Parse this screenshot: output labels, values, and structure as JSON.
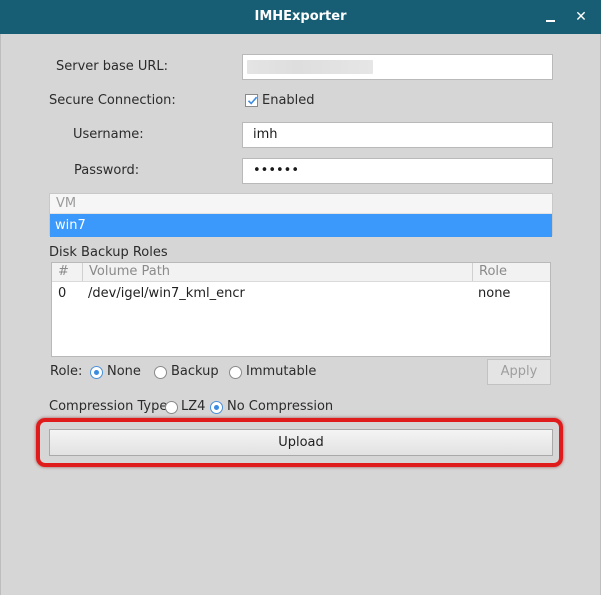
{
  "window": {
    "title": "IMHExporter"
  },
  "form": {
    "server_label": "Server base URL:",
    "server_value": "",
    "secure_label": "Secure Connection:",
    "secure_checkbox_label": "Enabled",
    "secure_checked": true,
    "username_label": "Username:",
    "username_value": "imh",
    "password_label": "Password:",
    "password_value": "••••••"
  },
  "vm_list": {
    "header": "VM",
    "items": [
      {
        "label": "win7",
        "selected": true
      }
    ]
  },
  "disk_backup": {
    "title": "Disk Backup Roles",
    "columns": [
      "#",
      "Volume Path",
      "Role"
    ],
    "rows": [
      {
        "index": "0",
        "path": "/dev/igel/win7_kml_encr",
        "role": "none"
      }
    ],
    "role_label": "Role:",
    "role_options": [
      {
        "label": "None",
        "selected": true
      },
      {
        "label": "Backup",
        "selected": false
      },
      {
        "label": "Immutable",
        "selected": false
      }
    ],
    "apply_label": "Apply"
  },
  "compression": {
    "label": "Compression Type:",
    "options": [
      {
        "label": "LZ4",
        "selected": false
      },
      {
        "label": "No Compression",
        "selected": true
      }
    ]
  },
  "upload_label": "Upload",
  "colors": {
    "titlebar": "#175e74",
    "selection": "#3b99fc",
    "highlight": "#e01b1b"
  }
}
